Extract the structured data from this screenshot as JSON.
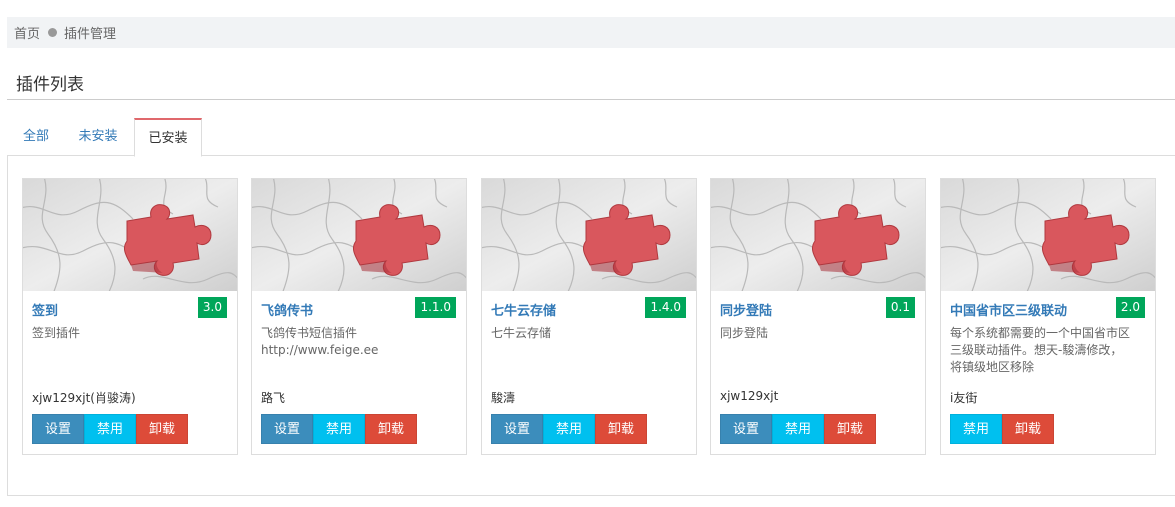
{
  "breadcrumb": {
    "home": "首页",
    "current": "插件管理"
  },
  "page_title": "插件列表",
  "tabs": [
    {
      "label": "全部",
      "active": false
    },
    {
      "label": "未安装",
      "active": false
    },
    {
      "label": "已安装",
      "active": true
    }
  ],
  "buttons": {
    "settings": "设置",
    "disable": "禁用",
    "uninstall": "卸载"
  },
  "colors": {
    "version_badge": "#00a65a",
    "settings": "#3c8dbc",
    "disable": "#00c0ef",
    "uninstall": "#dd4b39",
    "puzzle_piece": "#d9575d"
  },
  "plugins": [
    {
      "name": "签到",
      "version": "3.0",
      "desc_lines": [
        "签到插件"
      ],
      "author": "xjw129xjt(肖骏涛)",
      "has_settings": true
    },
    {
      "name": "飞鸽传书",
      "version": "1.1.0",
      "desc_lines": [
        "飞鸽传书短信插件",
        "http://www.feige.ee"
      ],
      "author": "路飞",
      "has_settings": true
    },
    {
      "name": "七牛云存储",
      "version": "1.4.0",
      "desc_lines": [
        "七牛云存储"
      ],
      "author": "駿濤",
      "has_settings": true
    },
    {
      "name": "同步登陆",
      "version": "0.1",
      "desc_lines": [
        "同步登陆"
      ],
      "author": "xjw129xjt",
      "has_settings": true
    },
    {
      "name": "中国省市区三级联动",
      "version": "2.0",
      "desc_lines": [
        "每个系统都需要的一个中国省市区",
        "三级联动插件。想天-駿濤修改，",
        "将镇级地区移除"
      ],
      "author": "i友街",
      "has_settings": false
    }
  ]
}
